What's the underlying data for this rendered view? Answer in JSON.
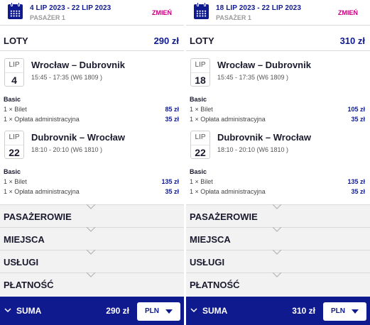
{
  "panels": [
    {
      "dates": "4 LIP 2023 - 22 LIP 2023",
      "passengers": "PASAŻER 1",
      "change_label": "ZMIEŃ",
      "flights_label": "LOTY",
      "flights_total": "290 zł",
      "outbound": {
        "month": "LIP",
        "day": "4",
        "route": "Wrocław – Dubrovnik",
        "times": "15:45 - 17:35 (W6 1809 )"
      },
      "outbound_fare": {
        "type": "Basic",
        "ticket_label": "1 × Bilet",
        "ticket_price": "85 zł",
        "fee_label": "1 × Opłata administracyjna",
        "fee_price": "35 zł"
      },
      "inbound": {
        "month": "LIP",
        "day": "22",
        "route": "Dubrovnik – Wrocław",
        "times": "18:10 - 20:10 (W6 1810 )"
      },
      "inbound_fare": {
        "type": "Basic",
        "ticket_label": "1 × Bilet",
        "ticket_price": "135 zł",
        "fee_label": "1 × Opłata administracyjna",
        "fee_price": "35 zł"
      },
      "sections": [
        "PASAŻEROWIE",
        "MIEJSCA",
        "USŁUGI",
        "PŁATNOŚĆ"
      ],
      "sum_label": "SUMA",
      "sum_price": "290 zł",
      "currency": "PLN"
    },
    {
      "dates": "18 LIP 2023 - 22 LIP 2023",
      "passengers": "PASAŻER 1",
      "change_label": "ZMIEŃ",
      "flights_label": "LOTY",
      "flights_total": "310 zł",
      "outbound": {
        "month": "LIP",
        "day": "18",
        "route": "Wrocław – Dubrovnik",
        "times": "15:45 - 17:35 (W6 1809 )"
      },
      "outbound_fare": {
        "type": "Basic",
        "ticket_label": "1 × Bilet",
        "ticket_price": "105 zł",
        "fee_label": "1 × Opłata administracyjna",
        "fee_price": "35 zł"
      },
      "inbound": {
        "month": "LIP",
        "day": "22",
        "route": "Dubrovnik – Wrocław",
        "times": "18:10 - 20:10 (W6 1810 )"
      },
      "inbound_fare": {
        "type": "Basic",
        "ticket_label": "1 × Bilet",
        "ticket_price": "135 zł",
        "fee_label": "1 × Opłata administracyjna",
        "fee_price": "35 zł"
      },
      "sections": [
        "PASAŻEROWIE",
        "MIEJSCA",
        "USŁUGI",
        "PŁATNOŚĆ"
      ],
      "sum_label": "SUMA",
      "sum_price": "310 zł",
      "currency": "PLN"
    }
  ],
  "colors": {
    "brand_navy": "#0f1a8f",
    "accent_magenta": "#c6007e",
    "section_bg": "#f2f2f2"
  },
  "icons": {
    "calendar": "calendar-icon",
    "section_chevron": "chevron-down-icon",
    "sum_chevron": "chevron-down-icon",
    "currency_dropdown": "caret-down-icon"
  }
}
